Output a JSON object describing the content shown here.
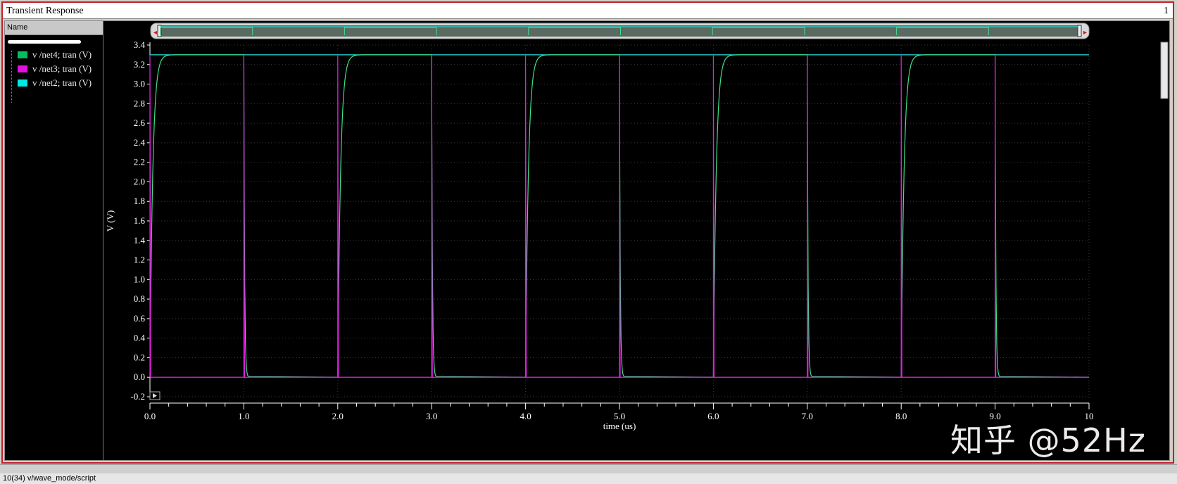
{
  "window": {
    "title": "Transient Response",
    "number": "1"
  },
  "sidebar": {
    "header": "Name",
    "items": [
      {
        "label": "v /net4; tran (V)",
        "color": "#00c060"
      },
      {
        "label": "v /net3; tran (V)",
        "color": "#e010e0"
      },
      {
        "label": "v /net2; tran (V)",
        "color": "#00e8e8"
      }
    ]
  },
  "colors": {
    "net4": "#3fe08a",
    "net3": "#e020e0",
    "net2": "#20e0e0",
    "grid": "#3a3a3a",
    "axis": "#ffffff"
  },
  "chart_data": {
    "type": "line",
    "xlabel": "time (us)",
    "ylabel": "V (V)",
    "xlim": [
      0,
      10
    ],
    "ylim": [
      -0.2,
      3.4
    ],
    "x_ticks": [
      "0.0",
      "1.0",
      "2.0",
      "3.0",
      "4.0",
      "5.0",
      "6.0",
      "7.0",
      "8.0",
      "9.0",
      "10"
    ],
    "y_ticks": [
      "-0.2",
      "0.0",
      "0.2",
      "0.4",
      "0.6",
      "0.8",
      "1.0",
      "1.2",
      "1.4",
      "1.6",
      "1.8",
      "2.0",
      "2.2",
      "2.4",
      "2.6",
      "2.8",
      "3.0",
      "3.2",
      "3.4"
    ],
    "grid": true,
    "series": [
      {
        "name": "v /net4; tran (V)",
        "key": "net4",
        "description_values": {
          "high": 3.3,
          "low": 0.0,
          "period_us": 2.0,
          "rises_at_us": [
            0,
            2,
            4,
            6,
            8
          ],
          "falls_at_us": [
            1,
            3,
            5,
            7,
            9
          ],
          "rise_time_constant_us": 0.03
        }
      },
      {
        "name": "v /net3; tran (V)",
        "key": "net3",
        "description_values": {
          "spike_times_us": [
            0,
            1,
            2,
            3,
            4,
            5,
            6,
            7,
            8,
            9
          ],
          "peak": 3.3,
          "baseline": 0.0
        }
      },
      {
        "name": "v /net2; tran (V)",
        "key": "net2",
        "description_values": {
          "constant": 3.3
        }
      }
    ]
  },
  "watermark": "知乎 @52Hz",
  "status": {
    "left": "10(34)    v/wave_mode/script"
  }
}
